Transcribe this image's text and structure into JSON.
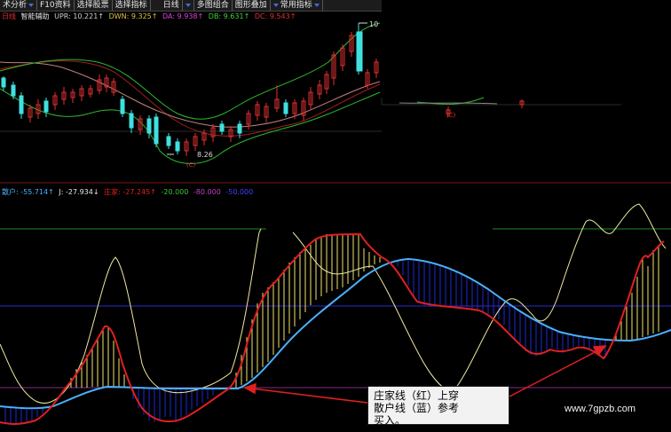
{
  "toolbar": {
    "items": [
      "术分析",
      "F10资料",
      "选择股票",
      "选择指标",
      "日线",
      "多图组合",
      "图形叠加",
      "常用指标"
    ]
  },
  "top_panel": {
    "period": "日线",
    "indicator_name": "智能辅助",
    "upr": "UPR: 10.221↑",
    "dwn": "DWN: 9.325↑",
    "da": "DA: 9.938↑",
    "db": "DB: 9.631↑",
    "dc": "DC: 9.543↑",
    "label_high": "10",
    "label_low": "8.26",
    "marker_c1": "(C)",
    "marker_c2": "(C)"
  },
  "bottom_panel": {
    "sanhu": "散户: -55.714↑",
    "j": "J: -27.934↓",
    "zhuang": "庄家: -27.245↑",
    "l20": "-20.000",
    "l80": "-80.000",
    "l50": "-50.000"
  },
  "callout": {
    "line1": "庄家线（红）上穿",
    "line2": "散户线（蓝）参考",
    "line3": "买入。"
  },
  "watermark": "www.7gpzb.com",
  "colors": {
    "background": "#000000",
    "up_candle": "#e03030",
    "down_candle": "#40e0e0",
    "zhuang_line": "#e02020",
    "sanhu_line": "#4ab0ff",
    "j_line": "#f0e8a0",
    "ref_green": "#1e8c1e",
    "ref_blue": "#2a2ad0",
    "ref_purple": "#8a2a8a",
    "fill_up": "#f4e36a",
    "fill_down": "#1e2ad8",
    "boll": "#2eb82e",
    "ma": "#a02020"
  },
  "icons": {
    "dropdown": "dropdown-triangle-icon"
  }
}
